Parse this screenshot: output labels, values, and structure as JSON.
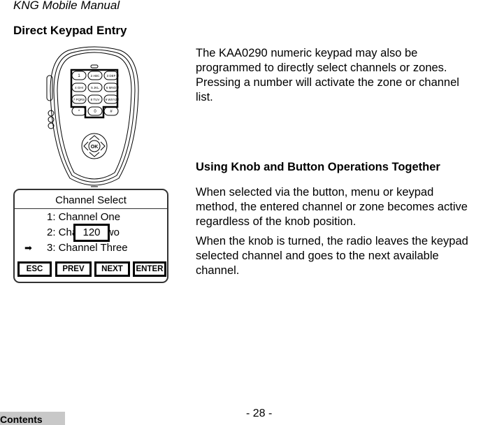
{
  "header": {
    "manual_title": "KNG Mobile Manual"
  },
  "section": {
    "title": "Direct Keypad Entry"
  },
  "body": {
    "intro_lines": [
      "The KAA0290 numeric keypad may also be",
      "programmed to directly select channels or zones.",
      "Pressing a number will activate the zone or channel",
      "list."
    ],
    "subheading": "Using Knob and Button Operations Together",
    "para1_lines": [
      "When selected via the button, menu or keypad",
      "method, the entered channel or zone becomes active",
      "regardless of the knob position."
    ],
    "para2_lines": [
      "When the knob is turned, the radio leaves the keypad",
      "selected channel and goes to the next available",
      "channel."
    ]
  },
  "microphone": {
    "keys": [
      {
        "num": "1",
        "letters": ""
      },
      {
        "num": "2",
        "letters": "ABC"
      },
      {
        "num": "3",
        "letters": "DEF"
      },
      {
        "num": "4",
        "letters": "GHI"
      },
      {
        "num": "5",
        "letters": "JKL"
      },
      {
        "num": "6",
        "letters": "MNO"
      },
      {
        "num": "7",
        "letters": "PQRS"
      },
      {
        "num": "8",
        "letters": "TUV"
      },
      {
        "num": "9",
        "letters": "WXYZ"
      },
      {
        "num": "*",
        "letters": ""
      },
      {
        "num": "0",
        "letters": ""
      },
      {
        "num": "#",
        "letters": ""
      }
    ],
    "ok_label": "OK"
  },
  "screen": {
    "title": "Channel Select",
    "items": [
      "1: Channel One",
      "2: Channel Two",
      "3: Channel Three"
    ],
    "selected_index": 2,
    "selected_marker": "➡",
    "entry_popup": "120",
    "softkeys": [
      "ESC",
      "PREV",
      "NEXT",
      "ENTER"
    ]
  },
  "footer": {
    "contents_label": "Contents",
    "page_number": "- 28 -"
  }
}
